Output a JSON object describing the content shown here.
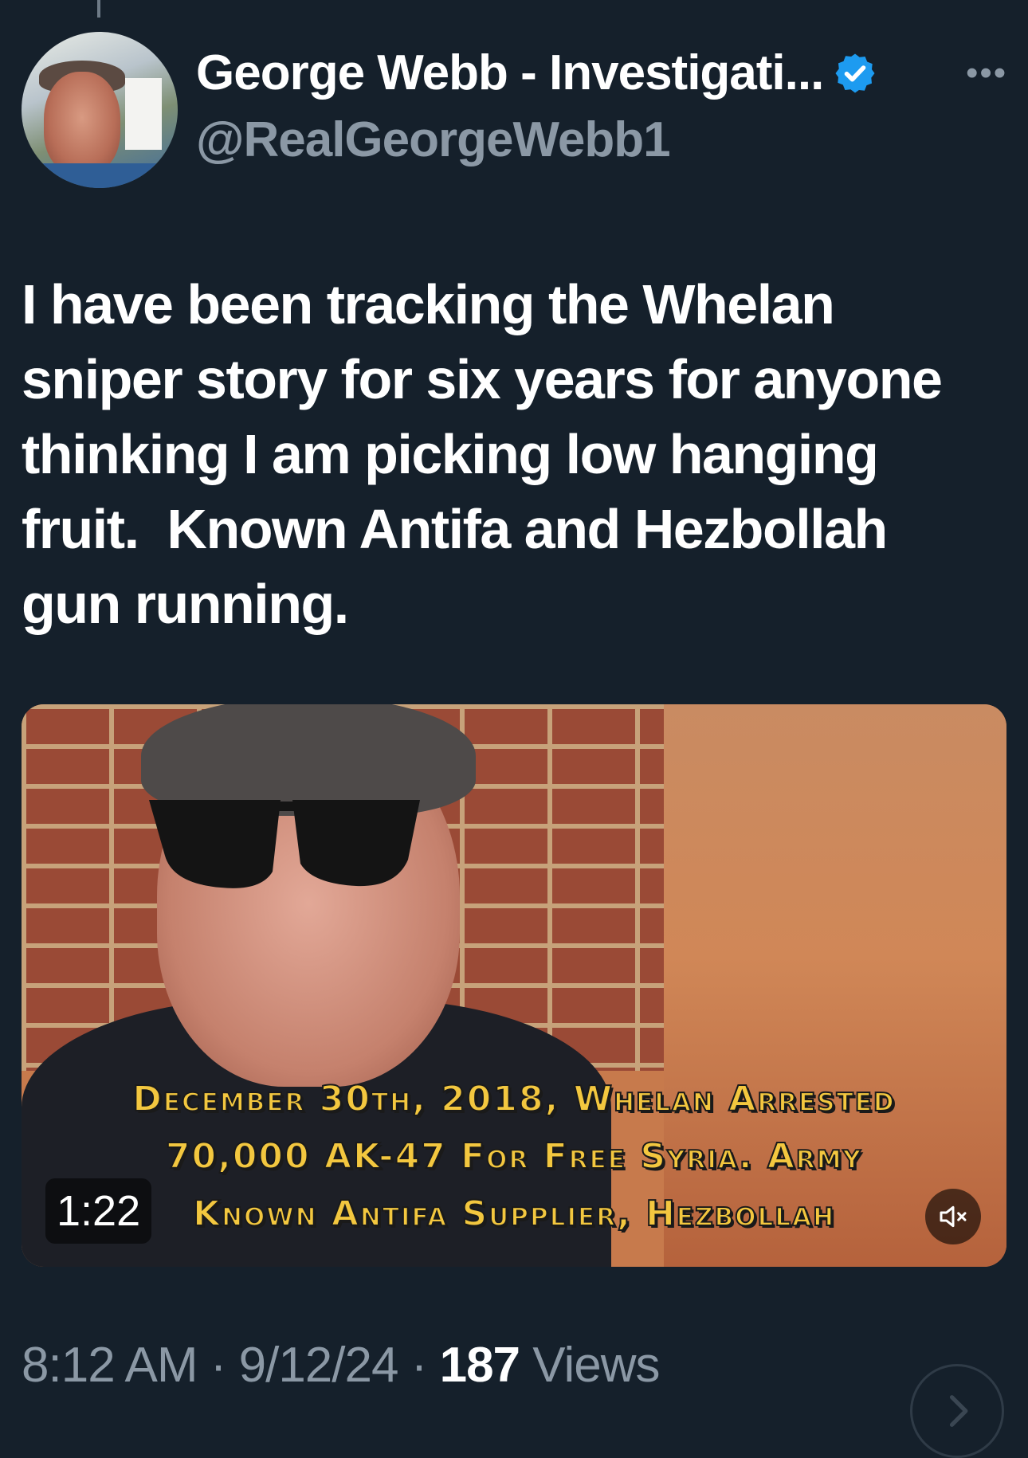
{
  "author": {
    "display_name": "George Webb - Investigati...",
    "handle": "@RealGeorgeWebb1",
    "verified": true
  },
  "tweet": {
    "text": "I have been tracking the Whelan\nsniper story for six years for anyone\nthinking I am picking low hanging\nfruit.  Known Antifa and Hezbollah\ngun running."
  },
  "video": {
    "caption_line1": "December 30th, 2018, Whelan Arrested",
    "caption_line2": "70,000 AK-47 For Free Syria. Army",
    "caption_line3": "Known Antifa Supplier, Hezbollah",
    "duration": "1:22",
    "muted": true
  },
  "meta": {
    "time": "8:12 AM",
    "date": "9/12/24",
    "separator": "·",
    "views_count": "187",
    "views_label": "Views"
  },
  "colors": {
    "background": "#15202b",
    "secondary_text": "#8b98a5",
    "verified_badge": "#1d9bf0",
    "caption_text": "#f3c73f"
  },
  "icons": {
    "verified": "verified-badge-icon",
    "more": "more-options-icon",
    "mute": "speaker-muted-icon",
    "scroll": "chevron-right-icon"
  }
}
